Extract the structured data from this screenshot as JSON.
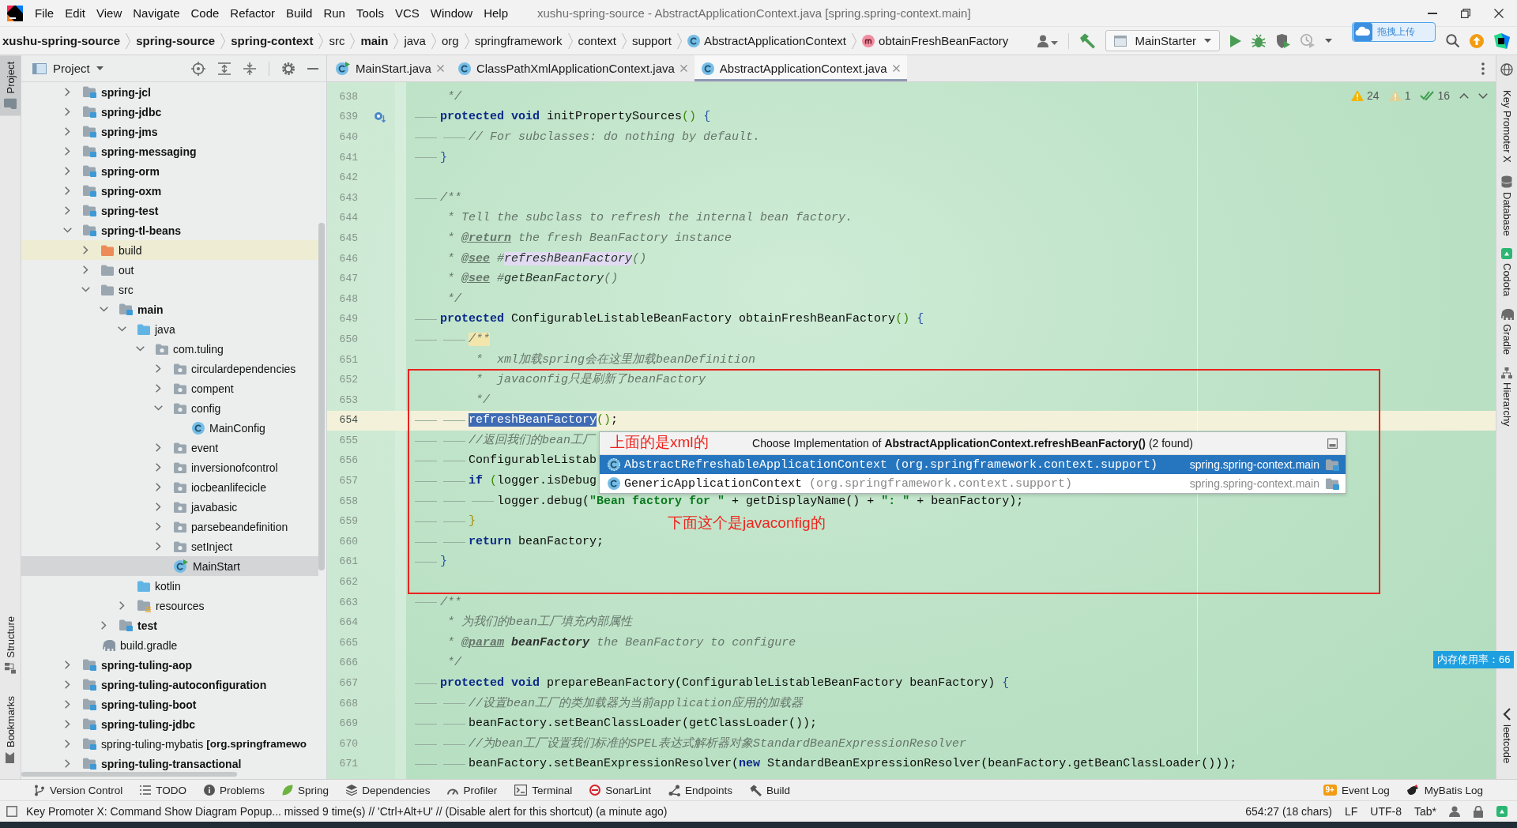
{
  "window": {
    "title": "xushu-spring-source - AbstractApplicationContext.java [spring.spring-context.main]"
  },
  "menu": [
    "File",
    "Edit",
    "View",
    "Navigate",
    "Code",
    "Refactor",
    "Build",
    "Run",
    "Tools",
    "VCS",
    "Window",
    "Help"
  ],
  "breadcrumbs": [
    {
      "label": "xushu-spring-source",
      "kind": "module"
    },
    {
      "label": "spring-source",
      "kind": "module"
    },
    {
      "label": "spring-context",
      "kind": "module"
    },
    {
      "label": "src",
      "kind": "folder"
    },
    {
      "label": "main",
      "kind": "module"
    },
    {
      "label": "java",
      "kind": "folder"
    },
    {
      "label": "org",
      "kind": "folder"
    },
    {
      "label": "springframework",
      "kind": "folder"
    },
    {
      "label": "context",
      "kind": "folder"
    },
    {
      "label": "support",
      "kind": "folder"
    },
    {
      "label": "AbstractApplicationContext",
      "kind": "class"
    },
    {
      "label": "obtainFreshBeanFactory",
      "kind": "method"
    }
  ],
  "toolbar": {
    "run_configuration": "MainStarter"
  },
  "upload_widget": {
    "label": "拖拽上传"
  },
  "left_strip": {
    "top": [
      {
        "label": "Project",
        "kind": "project",
        "selected": true
      }
    ],
    "bottom": [
      {
        "label": "Structure",
        "kind": "structure",
        "selected": false
      },
      {
        "label": "Bookmarks",
        "kind": "bookmarks",
        "selected": false
      }
    ]
  },
  "project_panel": {
    "title": "Project",
    "tree": [
      {
        "label": "spring-jcl",
        "kind": "module",
        "expanded": false,
        "selected": false
      },
      {
        "label": "spring-jdbc",
        "kind": "module",
        "expanded": false,
        "selected": false
      },
      {
        "label": "spring-jms",
        "kind": "module",
        "expanded": false,
        "selected": false
      },
      {
        "label": "spring-messaging",
        "kind": "module",
        "expanded": false,
        "selected": false
      },
      {
        "label": "spring-orm",
        "kind": "module",
        "expanded": false,
        "selected": false
      },
      {
        "label": "spring-oxm",
        "kind": "module",
        "expanded": false,
        "selected": false
      },
      {
        "label": "spring-test",
        "kind": "module",
        "expanded": false,
        "selected": false
      },
      {
        "label": "spring-tl-beans",
        "kind": "module",
        "expanded": true,
        "selected": false,
        "children": [
          {
            "label": "build",
            "kind": "excluded-folder",
            "expanded": false,
            "selected": false
          },
          {
            "label": "out",
            "kind": "folder",
            "expanded": false,
            "selected": false
          },
          {
            "label": "src",
            "kind": "folder",
            "expanded": true,
            "selected": false,
            "children": [
              {
                "label": "main",
                "kind": "module",
                "expanded": true,
                "selected": false,
                "children": [
                  {
                    "label": "java",
                    "kind": "source-root",
                    "expanded": true,
                    "selected": false,
                    "children": [
                      {
                        "label": "com.tuling",
                        "kind": "package",
                        "expanded": true,
                        "selected": false,
                        "children": [
                          {
                            "label": "circulardependencies",
                            "kind": "package",
                            "expanded": false,
                            "selected": false
                          },
                          {
                            "label": "compent",
                            "kind": "package",
                            "expanded": false,
                            "selected": false
                          },
                          {
                            "label": "config",
                            "kind": "package",
                            "expanded": true,
                            "selected": false,
                            "children": [
                              {
                                "label": "MainConfig",
                                "kind": "class",
                                "selected": false
                              }
                            ]
                          },
                          {
                            "label": "event",
                            "kind": "package",
                            "expanded": false,
                            "selected": false
                          },
                          {
                            "label": "inversionofcontrol",
                            "kind": "package",
                            "expanded": false,
                            "selected": false
                          },
                          {
                            "label": "iocbeanlifecicle",
                            "kind": "package",
                            "expanded": false,
                            "selected": false
                          },
                          {
                            "label": "javabasic",
                            "kind": "package",
                            "expanded": false,
                            "selected": false
                          },
                          {
                            "label": "parsebeandefinition",
                            "kind": "package",
                            "expanded": false,
                            "selected": false
                          },
                          {
                            "label": "setInject",
                            "kind": "package",
                            "expanded": false,
                            "selected": false
                          },
                          {
                            "label": "MainStart",
                            "kind": "runnable-class",
                            "selected": true
                          }
                        ]
                      }
                    ]
                  },
                  {
                    "label": "kotlin",
                    "kind": "source-root",
                    "selected": false
                  },
                  {
                    "label": "resources",
                    "kind": "resources",
                    "expanded": false,
                    "selected": false
                  }
                ]
              },
              {
                "label": "test",
                "kind": "module",
                "expanded": false,
                "selected": false
              }
            ]
          },
          {
            "label": "build.gradle",
            "kind": "gradle-file",
            "selected": false
          }
        ]
      },
      {
        "label": "spring-tuling-aop",
        "kind": "module",
        "expanded": false,
        "selected": false
      },
      {
        "label": "spring-tuling-autoconfiguration",
        "kind": "module",
        "expanded": false,
        "selected": false
      },
      {
        "label": "spring-tuling-boot",
        "kind": "module",
        "expanded": false,
        "selected": false
      },
      {
        "label": "spring-tuling-jdbc",
        "kind": "module",
        "expanded": false,
        "selected": false
      },
      {
        "label": "spring-tuling-mybatis",
        "qualifier": "[org.springframewo",
        "kind": "module",
        "expanded": false,
        "selected": false
      },
      {
        "label": "spring-tuling-transactional",
        "kind": "module",
        "expanded": false,
        "selected": false
      }
    ]
  },
  "editor_tabs": [
    {
      "label": "MainStart.java",
      "kind": "runnable-class",
      "selected": false
    },
    {
      "label": "ClassPathXmlApplicationContext.java",
      "kind": "class",
      "selected": false
    },
    {
      "label": "AbstractApplicationContext.java",
      "kind": "class",
      "selected": true
    }
  ],
  "editor": {
    "inspections": [
      {
        "kind": "warning",
        "count": "24"
      },
      {
        "kind": "weak-warning",
        "count": "1"
      },
      {
        "kind": "ok",
        "count": "16"
      }
    ],
    "lines": [
      {
        "number": "638",
        "kind": "code",
        "current": false,
        "tokens": [
          {
            "kind": "comment",
            "text": "\t */"
          }
        ]
      },
      {
        "number": "639",
        "kind": "implemented",
        "current": false,
        "tokens": [
          {
            "kind": "keyword",
            "text": "\tprotected void"
          },
          {
            "kind": "plain",
            "text": " initPropertySources"
          },
          {
            "kind": "paren",
            "text": "()"
          },
          {
            "kind": "brace",
            "text": " {"
          }
        ]
      },
      {
        "number": "640",
        "kind": "code",
        "current": false,
        "tokens": [
          {
            "kind": "comment",
            "text": "\t\t// For subclasses: do nothing by default."
          }
        ]
      },
      {
        "number": "641",
        "kind": "code",
        "current": false,
        "tokens": [
          {
            "kind": "brace",
            "text": "\t}"
          }
        ]
      },
      {
        "number": "642",
        "kind": "code",
        "current": false
      },
      {
        "number": "643",
        "kind": "code",
        "current": false,
        "tokens": [
          {
            "kind": "comment",
            "text": "\t/**"
          }
        ]
      },
      {
        "number": "644",
        "kind": "code",
        "current": false,
        "tokens": [
          {
            "kind": "comment",
            "text": "\t * Tell the subclass to refresh the internal bean factory."
          }
        ]
      },
      {
        "number": "645",
        "kind": "code",
        "current": false,
        "tokens": [
          {
            "kind": "comment",
            "text": "\t * "
          },
          {
            "kind": "doctag",
            "text": "@return"
          },
          {
            "kind": "comment",
            "text": " the fresh BeanFactory instance"
          }
        ]
      },
      {
        "number": "646",
        "kind": "code",
        "current": false,
        "tokens": [
          {
            "kind": "comment",
            "text": "\t * "
          },
          {
            "kind": "doctag",
            "text": "@see"
          },
          {
            "kind": "comment",
            "text": " #"
          },
          {
            "kind": "usage",
            "text": "refreshBeanFactory"
          },
          {
            "kind": "comment",
            "text": "()"
          }
        ]
      },
      {
        "number": "647",
        "kind": "code",
        "current": false,
        "tokens": [
          {
            "kind": "comment",
            "text": "\t * "
          },
          {
            "kind": "doctag",
            "text": "@see"
          },
          {
            "kind": "comment",
            "text": " #"
          },
          {
            "kind": "docref",
            "text": "getBeanFactory"
          },
          {
            "kind": "comment",
            "text": "()"
          }
        ]
      },
      {
        "number": "648",
        "kind": "code",
        "current": false,
        "tokens": [
          {
            "kind": "comment",
            "text": "\t */"
          }
        ]
      },
      {
        "number": "649",
        "kind": "code",
        "current": false,
        "tokens": [
          {
            "kind": "keyword",
            "text": "\tprotected"
          },
          {
            "kind": "plain",
            "text": " ConfigurableListableBeanFactory obtainFreshBeanFactory"
          },
          {
            "kind": "paren",
            "text": "()"
          },
          {
            "kind": "brace",
            "text": " {"
          }
        ]
      },
      {
        "number": "650",
        "kind": "code",
        "current": false,
        "tokens": [
          {
            "kind": "comment-marked",
            "text": "\t\t/**"
          }
        ]
      },
      {
        "number": "651",
        "kind": "code",
        "current": false,
        "tokens": [
          {
            "kind": "comment",
            "text": "\t\t *  xml加载spring会在这里加载beanDefinition"
          }
        ]
      },
      {
        "number": "652",
        "kind": "code",
        "current": false,
        "tokens": [
          {
            "kind": "comment",
            "text": "\t\t *  javaconfig只是刷新了beanFactory"
          }
        ]
      },
      {
        "number": "653",
        "kind": "code",
        "current": false,
        "tokens": [
          {
            "kind": "comment",
            "text": "\t\t */"
          }
        ]
      },
      {
        "number": "654",
        "kind": "code",
        "current": true,
        "tokens": [
          {
            "kind": "selection",
            "text": "\t\trefreshBeanFactory"
          },
          {
            "kind": "paren",
            "text": "()"
          },
          {
            "kind": "plain",
            "text": ";"
          }
        ]
      },
      {
        "number": "655",
        "kind": "code",
        "current": false,
        "tokens": [
          {
            "kind": "comment",
            "text": "\t\t//返回我们的bean工厂"
          }
        ]
      },
      {
        "number": "656",
        "kind": "code",
        "current": false,
        "tokens": [
          {
            "kind": "plain",
            "text": "\t\tConfigurableListab"
          }
        ]
      },
      {
        "number": "657",
        "kind": "code",
        "current": false,
        "tokens": [
          {
            "kind": "keyword",
            "text": "\t\tif"
          },
          {
            "kind": "paren",
            "text": " ("
          },
          {
            "kind": "plain",
            "text": "logger.isDebug"
          }
        ]
      },
      {
        "number": "658",
        "kind": "code",
        "current": false,
        "tokens": [
          {
            "kind": "plain",
            "text": "\t\t\tlogger.debug("
          },
          {
            "kind": "string",
            "text": "\"Bean factory for \""
          },
          {
            "kind": "plain",
            "text": " + getDisplayName() + "
          },
          {
            "kind": "string",
            "text": "\": \""
          },
          {
            "kind": "plain",
            "text": " + beanFactory);"
          }
        ]
      },
      {
        "number": "659",
        "kind": "code",
        "current": false,
        "tokens": [
          {
            "kind": "brace2",
            "text": "\t\t}"
          }
        ]
      },
      {
        "number": "660",
        "kind": "code",
        "current": false,
        "tokens": [
          {
            "kind": "keyword",
            "text": "\t\treturn"
          },
          {
            "kind": "plain",
            "text": " beanFactory;"
          }
        ]
      },
      {
        "number": "661",
        "kind": "code",
        "current": false,
        "tokens": [
          {
            "kind": "brace",
            "text": "\t}"
          }
        ]
      },
      {
        "number": "662",
        "kind": "code",
        "current": false
      },
      {
        "number": "663",
        "kind": "code",
        "current": false,
        "tokens": [
          {
            "kind": "comment",
            "text": "\t/**"
          }
        ]
      },
      {
        "number": "664",
        "kind": "code",
        "current": false,
        "tokens": [
          {
            "kind": "comment",
            "text": "\t * 为我们的bean工厂填充内部属性"
          }
        ]
      },
      {
        "number": "665",
        "kind": "code",
        "current": false,
        "tokens": [
          {
            "kind": "comment",
            "text": "\t * "
          },
          {
            "kind": "doctag",
            "text": "@param"
          },
          {
            "kind": "docparam",
            "text": " beanFactory"
          },
          {
            "kind": "comment",
            "text": " the BeanFactory to configure"
          }
        ]
      },
      {
        "number": "666",
        "kind": "code",
        "current": false,
        "tokens": [
          {
            "kind": "comment",
            "text": "\t */"
          }
        ]
      },
      {
        "number": "667",
        "kind": "code",
        "current": false,
        "tokens": [
          {
            "kind": "keyword",
            "text": "\tprotected void"
          },
          {
            "kind": "plain",
            "text": " prepareBeanFactory(ConfigurableListableBeanFactory beanFactory)"
          },
          {
            "kind": "brace",
            "text": " {"
          }
        ]
      },
      {
        "number": "668",
        "kind": "code",
        "current": false,
        "tokens": [
          {
            "kind": "comment",
            "text": "\t\t//设置bean工厂的类加载器为当前application应用的加载器"
          }
        ]
      },
      {
        "number": "669",
        "kind": "code",
        "current": false,
        "tokens": [
          {
            "kind": "plain",
            "text": "\t\tbeanFactory.setBeanClassLoader(getClassLoader());"
          }
        ]
      },
      {
        "number": "670",
        "kind": "code",
        "current": false,
        "tokens": [
          {
            "kind": "comment",
            "text": "\t\t//为bean工厂设置我们标准的SPEL表达式解析器对象StandardBeanExpressionResolver"
          }
        ]
      },
      {
        "number": "671",
        "kind": "code",
        "current": false,
        "tokens": [
          {
            "kind": "plain",
            "text": "\t\tbeanFactory.setBeanExpressionResolver("
          },
          {
            "kind": "keyword",
            "text": "new"
          },
          {
            "kind": "plain",
            "text": " StandardBeanExpressionResolver(beanFactory.getBeanClassLoader()));"
          }
        ]
      }
    ],
    "popup": {
      "title": "Choose Implementation of **AbstractApplicationContext.refreshBeanFactory()** (2 found)",
      "items": [
        {
          "name": "AbstractRefreshableApplicationContext",
          "package": "(org.springframework.context.support)",
          "module": "spring.spring-context.main",
          "kind": "abstract-class",
          "selected": true
        },
        {
          "name": "GenericApplicationContext",
          "package": "(org.springframework.context.support)",
          "module": "spring.spring-context.main",
          "kind": "class",
          "selected": false
        }
      ]
    },
    "annotations": [
      {
        "text": "上面的是xml的"
      },
      {
        "text": "下面这个是javaconfig的"
      }
    ]
  },
  "memory_widget": {
    "label": "内存使用率：66"
  },
  "right_strip": [
    {
      "label": "Key Promoter X",
      "kind": "plain"
    },
    {
      "label": "Database",
      "kind": "database"
    },
    {
      "label": "Codota",
      "kind": "codota"
    },
    {
      "label": "Gradle",
      "kind": "gradle"
    },
    {
      "label": "Hierarchy",
      "kind": "hierarchy"
    },
    {
      "label": "leetcode",
      "kind": "leetcode"
    }
  ],
  "tool_windows": {
    "left": [
      {
        "label": "Version Control",
        "kind": "vcs"
      },
      {
        "label": "TODO",
        "kind": "todo"
      },
      {
        "label": "Problems",
        "kind": "problems"
      },
      {
        "label": "Spring",
        "kind": "spring"
      },
      {
        "label": "Dependencies",
        "kind": "dependencies"
      },
      {
        "label": "Profiler",
        "kind": "profiler"
      },
      {
        "label": "Terminal",
        "kind": "terminal"
      },
      {
        "label": "SonarLint",
        "kind": "sonarlint"
      },
      {
        "label": "Endpoints",
        "kind": "endpoints"
      },
      {
        "label": "Build",
        "kind": "build"
      }
    ],
    "right": [
      {
        "label": "Event Log",
        "kind": "event-log",
        "badge": "9+"
      },
      {
        "label": "MyBatis Log",
        "kind": "mybatis"
      }
    ]
  },
  "status_bar": {
    "message": "Key Promoter X: Command Show Diagram Popup... missed 9 time(s) // 'Ctrl+Alt+U' // (Disable alert for this shortcut) (a minute ago)",
    "position": "654:27 (18 chars)",
    "line_separator": "LF",
    "encoding": "UTF-8",
    "indent": "Tab*"
  }
}
